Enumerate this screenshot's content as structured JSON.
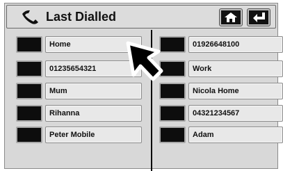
{
  "header": {
    "title": "Last  Dialled",
    "icons": {
      "phone": "phone-handset-icon",
      "home": "home-icon",
      "back": "back-arrow-icon"
    }
  },
  "contacts": {
    "left": [
      "Home",
      "01235654321",
      "Mum",
      "Rihanna",
      "Peter Mobile"
    ],
    "right": [
      "01926648100",
      "Work",
      "Nicola Home",
      "04321234567",
      "Adam"
    ]
  },
  "colors": {
    "background": "#d8d8d8",
    "swatch": "#0d0d0d",
    "label_bg": "#e8e8e8"
  }
}
